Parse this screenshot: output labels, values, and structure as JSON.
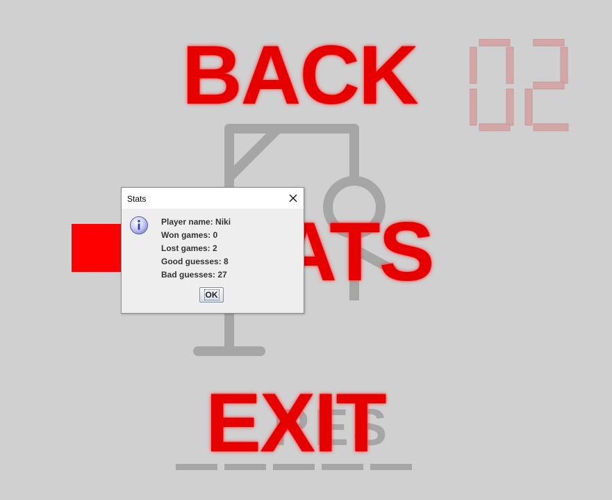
{
  "menu": {
    "back": "BACK",
    "stats": "STATS",
    "exit": "EXIT"
  },
  "word": {
    "revealed": "RES",
    "blank_count": 5
  },
  "counter": {
    "value": "02"
  },
  "dialog": {
    "title": "Stats",
    "icon": "info-icon",
    "lines": [
      "Player name: Niki",
      "Won games: 0",
      "Lost games: 2",
      "Good guesses: 8",
      "Bad guesses: 27"
    ],
    "ok_label": "OK"
  },
  "colors": {
    "background": "#d0d0d0",
    "menu_text": "#e60000",
    "gallows": "#a6a6a6",
    "counter": "#cfa0a0",
    "red_square": "#ff0000"
  }
}
